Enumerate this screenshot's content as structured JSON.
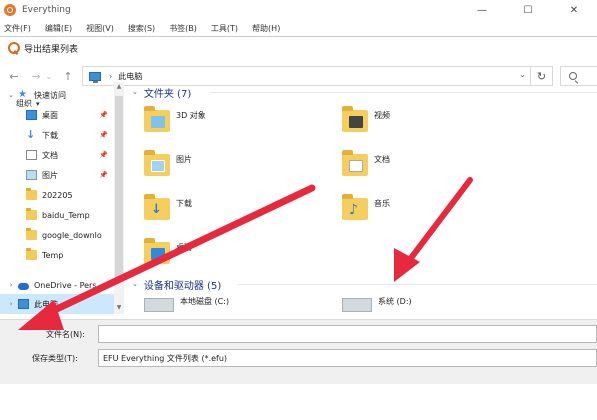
{
  "app": {
    "title": "Everything",
    "menu": [
      "文件(F)",
      "编辑(E)",
      "视图(V)",
      "搜索(S)",
      "书签(B)",
      "工具(T)",
      "帮助(H)"
    ],
    "controls": {
      "minimize": "—",
      "maximize": "☐",
      "close": "✕"
    }
  },
  "dialog": {
    "title": "导出结果列表",
    "nav": {
      "back": "←",
      "forward": "→",
      "dropdown": "⌄",
      "up": "↑"
    },
    "address": {
      "separator": "›",
      "location": "此电脑",
      "dropdown": "⌄",
      "refresh": "↻"
    },
    "toolbar": {
      "organize": "组织",
      "organize_caret": "▾"
    },
    "tree": {
      "collapse_glyph": "⌄",
      "expand_glyph": "›",
      "pin_glyph": "📌",
      "items": [
        {
          "label": "快速访问",
          "icon": "star-icon"
        },
        {
          "label": "桌面",
          "icon": "desktop-icon"
        },
        {
          "label": "下载",
          "icon": "download-icon"
        },
        {
          "label": "文档",
          "icon": "document-icon"
        },
        {
          "label": "图片",
          "icon": "pictures-icon"
        },
        {
          "label": "202205",
          "icon": "folder-icon"
        },
        {
          "label": "baidu_Temp",
          "icon": "folder-icon"
        },
        {
          "label": "google_downlo",
          "icon": "folder-icon"
        },
        {
          "label": "Temp",
          "icon": "folder-icon"
        },
        {
          "label": "OneDrive - Pers",
          "icon": "onedrive-icon"
        },
        {
          "label": "此电脑",
          "icon": "computer-icon"
        }
      ]
    },
    "content": {
      "folders_header": "文件夹 (7)",
      "folders": [
        {
          "label": "3D 对象"
        },
        {
          "label": "视频"
        },
        {
          "label": "图片"
        },
        {
          "label": "文档"
        },
        {
          "label": "下载"
        },
        {
          "label": "音乐"
        },
        {
          "label": "桌面"
        }
      ],
      "drives_header": "设备和驱动器 (5)",
      "drives": [
        {
          "label": "本地磁盘 (C:)"
        },
        {
          "label": "系统 (D:)"
        }
      ]
    },
    "form": {
      "filename_label": "文件名(N):",
      "filename_value": "",
      "filetype_label": "保存类型(T):",
      "filetype_value": "EFU Everything 文件列表 (*.efu)"
    }
  },
  "colors": {
    "selection": "#cce8ff",
    "group_title": "#1e3287",
    "arrow": "#e8283c"
  }
}
